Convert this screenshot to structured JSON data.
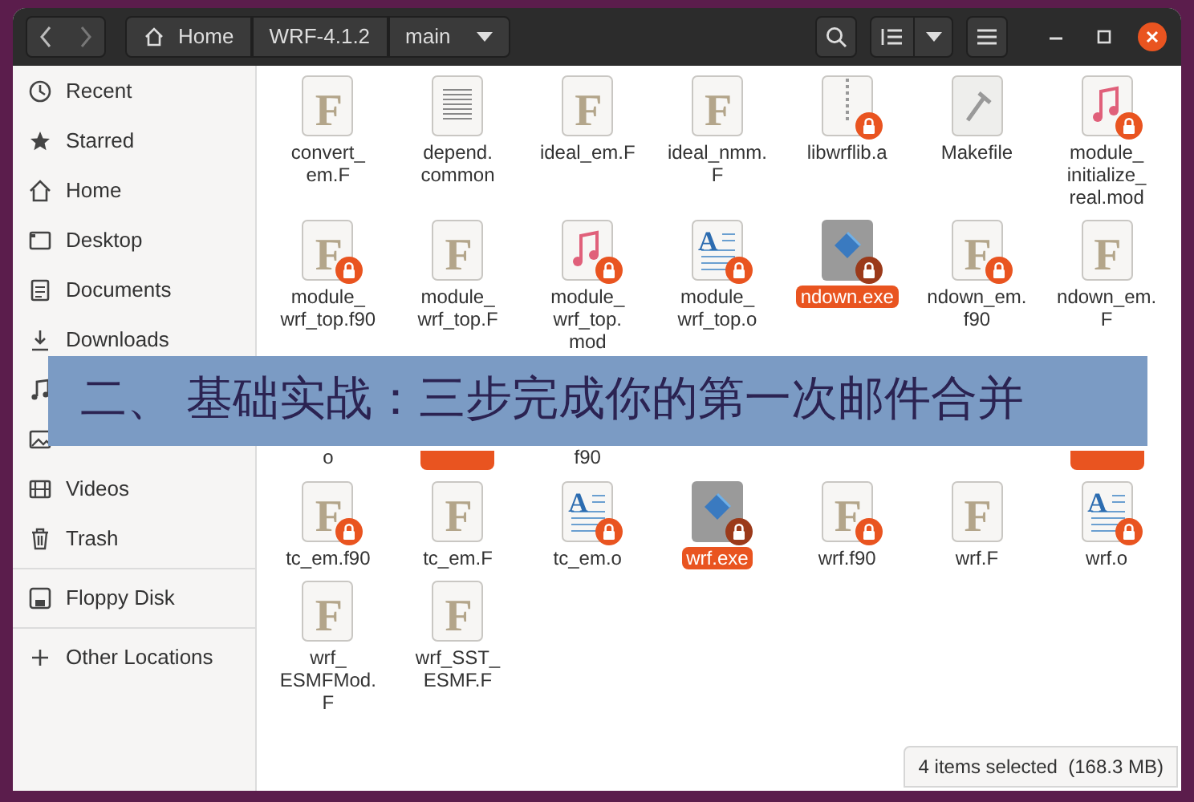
{
  "header": {
    "path": [
      {
        "label": "Home",
        "kind": "home"
      },
      {
        "label": "WRF-4.1.2",
        "kind": "plain"
      },
      {
        "label": "main",
        "kind": "dropdown"
      }
    ]
  },
  "sidebar": {
    "groups": [
      [
        {
          "label": "Recent",
          "kind": "recent"
        },
        {
          "label": "Starred",
          "kind": "starred"
        },
        {
          "label": "Home",
          "kind": "home"
        },
        {
          "label": "Desktop",
          "kind": "desktop"
        },
        {
          "label": "Documents",
          "kind": "documents"
        },
        {
          "label": "Downloads",
          "kind": "downloads"
        },
        {
          "kind": "music"
        },
        {
          "kind": "pictures"
        },
        {
          "label": "Videos",
          "kind": "videos"
        },
        {
          "label": "Trash",
          "kind": "trash"
        }
      ],
      [
        {
          "label": "Floppy Disk",
          "kind": "floppy"
        }
      ],
      [
        {
          "label": "Other Locations",
          "kind": "other"
        }
      ]
    ]
  },
  "files": [
    {
      "label": "convert_em.F",
      "kind": "fortran",
      "glyph": "F",
      "locked": false,
      "selected": false
    },
    {
      "label": "depend.common",
      "kind": "text",
      "locked": false,
      "selected": false
    },
    {
      "label": "ideal_em.F",
      "kind": "fortran",
      "glyph": "F",
      "locked": false,
      "selected": false
    },
    {
      "label": "ideal_nmm.F",
      "kind": "fortran",
      "glyph": "F",
      "locked": false,
      "selected": false
    },
    {
      "label": "libwrflib.a",
      "kind": "archive",
      "locked": true,
      "selected": false
    },
    {
      "label": "Makefile",
      "kind": "script",
      "locked": false,
      "selected": false
    },
    {
      "label": "module_initialize_real.mod",
      "kind": "audio",
      "locked": true,
      "selected": false
    },
    {
      "label": "module_wrf_top.f90",
      "kind": "fortran",
      "glyph": "F",
      "locked": true,
      "selected": false
    },
    {
      "label": "module_wrf_top.F",
      "kind": "fortran",
      "glyph": "F",
      "locked": false,
      "selected": false
    },
    {
      "label": "module_wrf_top.mod",
      "kind": "audio",
      "locked": true,
      "selected": false
    },
    {
      "label": "module_wrf_top.o",
      "kind": "object",
      "glyph": "A",
      "locked": true,
      "selected": false
    },
    {
      "label": "ndown.exe",
      "kind": "exe",
      "locked": true,
      "selected": true
    },
    {
      "label": "ndown_em.f90",
      "kind": "fortran",
      "glyph": "F",
      "locked": true,
      "selected": false
    },
    {
      "label": "ndown_em.F",
      "kind": "fortran",
      "glyph": "F",
      "locked": false,
      "selected": false
    },
    {
      "label": "o",
      "kind": "covered",
      "selected": false
    },
    {
      "kind": "covered",
      "selected": true
    },
    {
      "label": "f90",
      "kind": "covered",
      "selected": false
    },
    {
      "kind": "covered"
    },
    {
      "kind": "covered"
    },
    {
      "kind": "covered"
    },
    {
      "kind": "covered",
      "selected": true
    },
    {
      "label": "tc_em.f90",
      "kind": "fortran",
      "glyph": "F",
      "locked": true,
      "selected": false
    },
    {
      "label": "tc_em.F",
      "kind": "fortran",
      "glyph": "F",
      "locked": false,
      "selected": false
    },
    {
      "label": "tc_em.o",
      "kind": "object",
      "glyph": "A",
      "locked": true,
      "selected": false
    },
    {
      "label": "wrf.exe",
      "kind": "exe",
      "locked": true,
      "selected": true
    },
    {
      "label": "wrf.f90",
      "kind": "fortran",
      "glyph": "F",
      "locked": true,
      "selected": false
    },
    {
      "label": "wrf.F",
      "kind": "fortran",
      "glyph": "F",
      "locked": false,
      "selected": false
    },
    {
      "label": "wrf.o",
      "kind": "object",
      "glyph": "A",
      "locked": true,
      "selected": false
    },
    {
      "label": "wrf_ESMFMod.F",
      "kind": "fortran",
      "glyph": "F",
      "locked": false,
      "selected": false
    },
    {
      "label": "wrf_SST_ESMF.F",
      "kind": "fortran",
      "glyph": "F",
      "locked": false,
      "selected": false
    }
  ],
  "status_bar": "4 items selected  (168.3 MB)",
  "banner": "二、 基础实战：三步完成你的第一次邮件合并"
}
